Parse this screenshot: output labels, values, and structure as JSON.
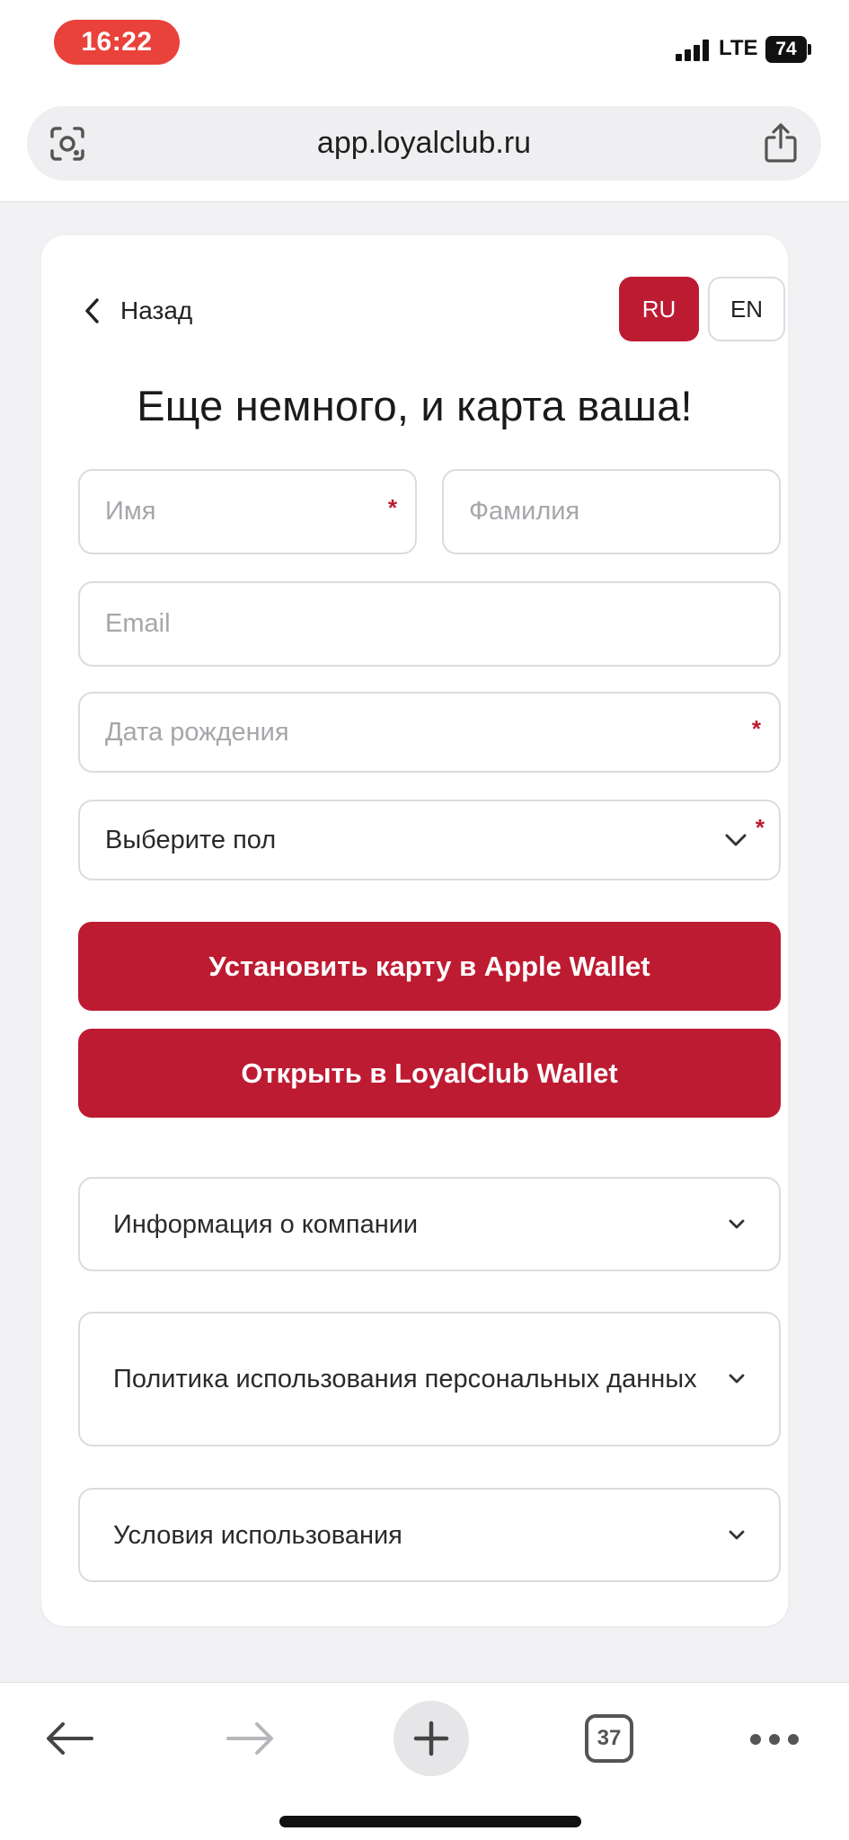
{
  "status_bar": {
    "time": "16:22",
    "network": "LTE",
    "battery": "74"
  },
  "browser": {
    "url": "app.loyalclub.ru",
    "tab_count": "37"
  },
  "form": {
    "back_label": "Назад",
    "lang_ru": "RU",
    "lang_en": "EN",
    "heading": "Еще немного, и карта ваша!",
    "first_name_placeholder": "Имя",
    "last_name_placeholder": "Фамилия",
    "email_placeholder": "Email",
    "birthdate_placeholder": "Дата рождения",
    "gender_select": "Выберите пол",
    "required_mark": "*",
    "apple_wallet_button": "Установить карту в Apple Wallet",
    "loyalclub_wallet_button": "Открыть в LoyalClub Wallet"
  },
  "accordions": [
    {
      "label": "Информация о компании"
    },
    {
      "label": "Политика использования персональных данных"
    },
    {
      "label": "Условия использования"
    }
  ],
  "colors": {
    "accent": "#bd1b32",
    "time_pill": "#e8423a"
  }
}
